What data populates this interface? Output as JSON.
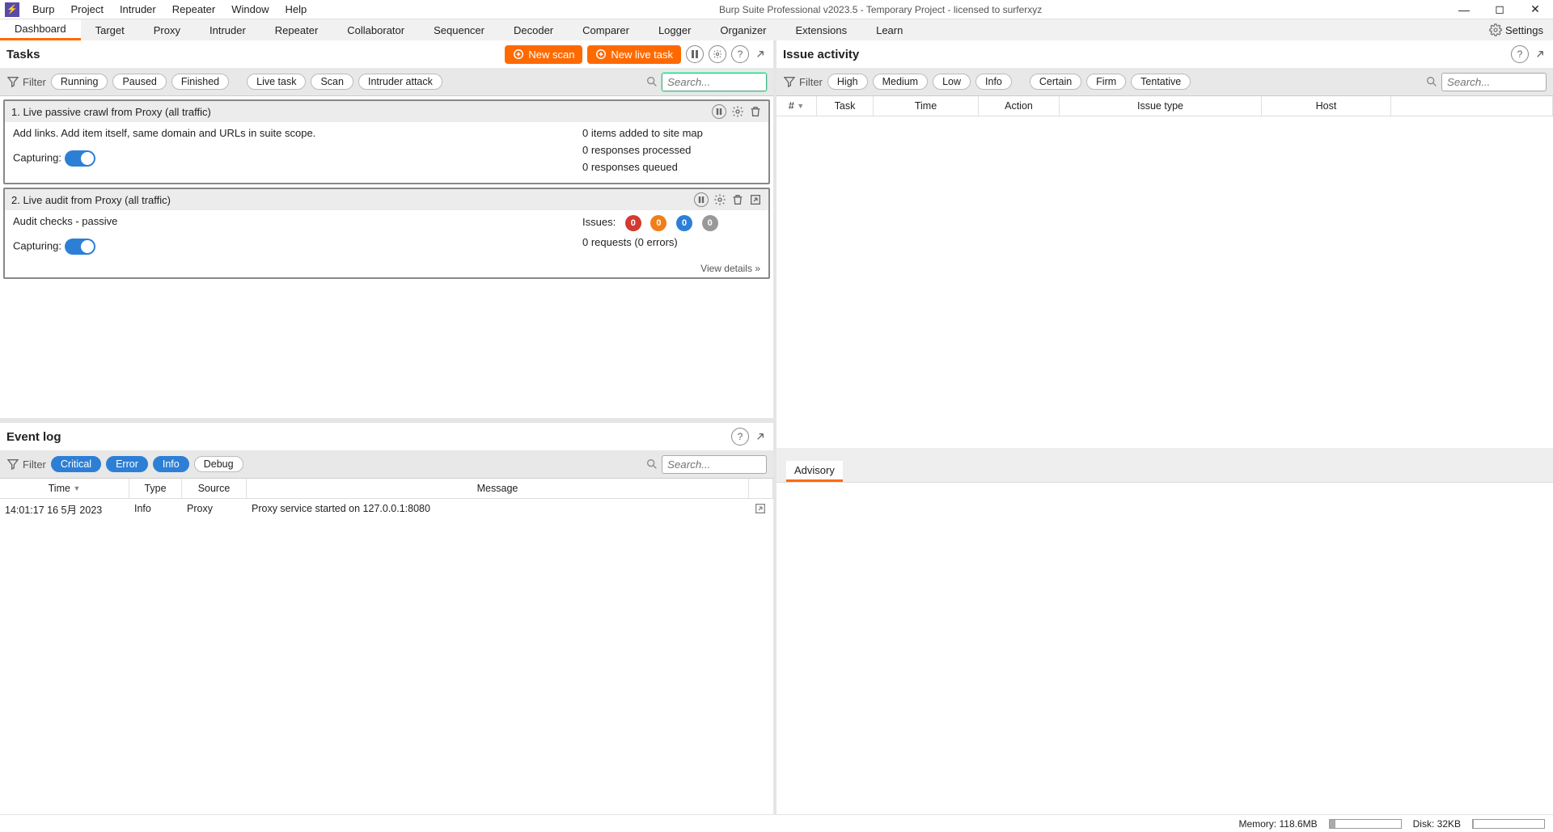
{
  "window": {
    "title": "Burp Suite Professional v2023.5 - Temporary Project - licensed to surferxyz"
  },
  "menubar": [
    "Burp",
    "Project",
    "Intruder",
    "Repeater",
    "Window",
    "Help"
  ],
  "tabs": [
    "Dashboard",
    "Target",
    "Proxy",
    "Intruder",
    "Repeater",
    "Collaborator",
    "Sequencer",
    "Decoder",
    "Comparer",
    "Logger",
    "Organizer",
    "Extensions",
    "Learn"
  ],
  "tabs_active": "Dashboard",
  "settings_label": "Settings",
  "tasks_panel": {
    "title": "Tasks",
    "new_scan": "New scan",
    "new_live_task": "New live task",
    "filter_label": "Filter",
    "filter_pills": [
      "Running",
      "Paused",
      "Finished"
    ],
    "filter_pills2": [
      "Live task",
      "Scan",
      "Intruder attack"
    ],
    "search_placeholder": "Search...",
    "cards": [
      {
        "title": "1. Live passive crawl from Proxy (all traffic)",
        "desc": "Add links. Add item itself, same domain and URLs in suite scope.",
        "capturing": "Capturing:",
        "stats": [
          "0 items added to site map",
          "0 responses processed",
          "0 responses queued"
        ]
      },
      {
        "title": "2. Live audit from Proxy (all traffic)",
        "desc": "Audit checks - passive",
        "capturing": "Capturing:",
        "issues_label": "Issues:",
        "issues": [
          {
            "v": "0",
            "c": "#d43a2f"
          },
          {
            "v": "0",
            "c": "#f07e1a"
          },
          {
            "v": "0",
            "c": "#2d7fd6"
          },
          {
            "v": "0",
            "c": "#999"
          }
        ],
        "reqs": "0 requests (0 errors)",
        "view_details": "View details"
      }
    ]
  },
  "eventlog": {
    "title": "Event log",
    "filter_label": "Filter",
    "pills": [
      {
        "t": "Critical",
        "on": true
      },
      {
        "t": "Error",
        "on": true
      },
      {
        "t": "Info",
        "on": true
      },
      {
        "t": "Debug",
        "on": false
      }
    ],
    "search_placeholder": "Search...",
    "cols": [
      "Time",
      "Type",
      "Source",
      "Message"
    ],
    "rows": [
      {
        "time": "14:01:17 16 5月 2023",
        "type": "Info",
        "source": "Proxy",
        "msg": "Proxy service started on 127.0.0.1:8080"
      }
    ]
  },
  "issue_panel": {
    "title": "Issue activity",
    "filter_label": "Filter",
    "pills1": [
      "High",
      "Medium",
      "Low",
      "Info"
    ],
    "pills2": [
      "Certain",
      "Firm",
      "Tentative"
    ],
    "search_placeholder": "Search...",
    "cols": [
      "#",
      "Task",
      "Time",
      "Action",
      "Issue type",
      "Host"
    ],
    "advisory_tab": "Advisory"
  },
  "status": {
    "memory_label": "Memory:",
    "memory_val": "118.6MB",
    "disk_label": "Disk:",
    "disk_val": "32KB"
  }
}
